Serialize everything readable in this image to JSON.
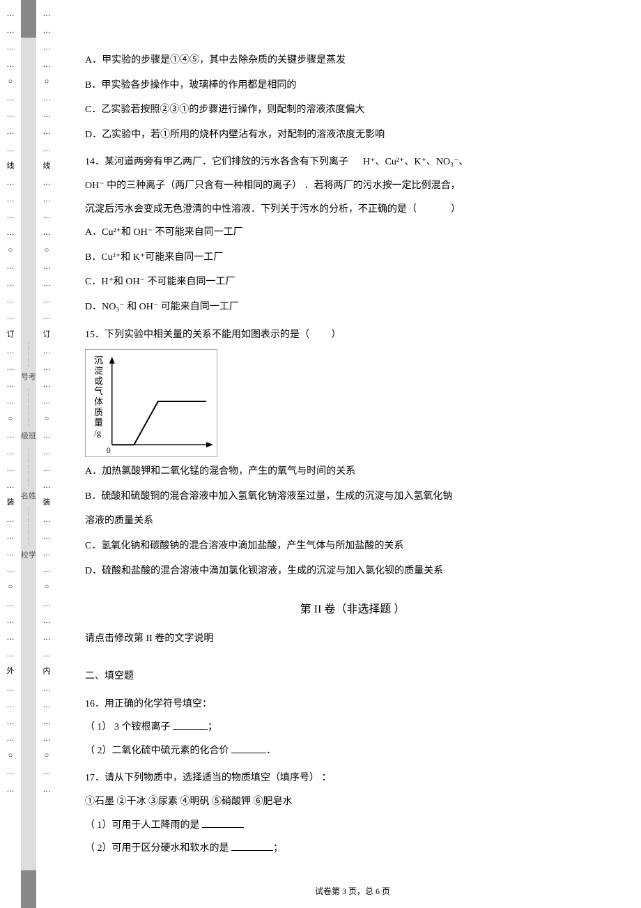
{
  "margin_outer": {
    "marks": [
      "…",
      "…",
      "…",
      "…",
      "○",
      "…",
      "…",
      "…",
      "…",
      "线",
      "…",
      "…",
      "…",
      "…",
      "○",
      "…",
      "…",
      "…",
      "…",
      "订",
      "…",
      "…",
      "…",
      "…",
      "○",
      "…",
      "…",
      "…",
      "…",
      "装",
      "…",
      "…",
      "…",
      "…",
      "○",
      "…",
      "…",
      "…",
      "…",
      "外",
      "…",
      "…",
      "…",
      "…",
      "○",
      "…",
      "…"
    ]
  },
  "margin_inner": {
    "marks": [
      "…",
      "…",
      "…",
      "…",
      "○",
      "…",
      "…",
      "…",
      "…",
      "线",
      "…",
      "…",
      "…",
      "…",
      "○",
      "…",
      "…",
      "…",
      "…",
      "订",
      "…",
      "…",
      "…",
      "…",
      "○",
      "…",
      "…",
      "…",
      "…",
      "装",
      "…",
      "…",
      "…",
      "…",
      "○",
      "…",
      "…",
      "…",
      "…",
      "内",
      "…",
      "…",
      "…",
      "…",
      "○",
      "…",
      "…"
    ]
  },
  "side_labels": {
    "kao": "号考",
    "ban": "级班",
    "xing": "名姓",
    "xiao": "校学"
  },
  "q13": {
    "A": "A．甲实验的步骤是①④⑤，其中去除杂质的关键步骤是蒸发",
    "B": "B．甲实验各步操作中，玻璃棒的作用都是相同的",
    "C": "C．乙实验若按照②③①的步骤进行操作，则配制的溶液浓度偏大",
    "D": "D．乙实验中，若①所用的烧杯内壁沾有水，对配制的溶液浓度无影响"
  },
  "q14": {
    "stem_a": "14．某河道两旁有甲乙两厂．它们排放的污水各含有下列离子",
    "ions": "H⁺、Cu²⁺、K⁺、NO₃⁻、",
    "stem_b": "OH⁻ 中的三种离子（两厂只含有一种相同的离子）   ．若将两厂的污水按一定比例混合，",
    "stem_c": "沉淀后污水会变成无色澄清的中性溶液．下列关于污水的分析，不正确的是（",
    "close": "）",
    "A": "A．Cu²⁺和 OH⁻ 不可能来自同一工厂",
    "B": "B．Cu²⁺和   K⁺可能来自同一工厂",
    "C": "C．H⁺和 OH⁻ 不可能来自同一工厂",
    "D": "D．NO₃⁻ 和 OH⁻  可能来自同一工厂"
  },
  "q15": {
    "stem": "15．下列实验中相关量的关系不能用如图表示的是（",
    "close": "）",
    "ylabel": "沉淀或气体质量/g",
    "origin": "0",
    "A": "A．加热氯酸钾和二氧化锰的混合物，产生的氧气与时间的关系",
    "B": "B．硫酸和硫酸铜的混合溶液中加入氢氧化钠溶液至过量，生成的沉淀与加入氢氧化钠",
    "B2": "溶液的质量关系",
    "C": "C．氢氧化钠和碳酸钠的混合溶液中滴加盐酸，产生气体与所加盐酸的关系",
    "D": "D．硫酸和盐酸的混合溶液中滴加氯化钡溶液，生成的沉淀与加入氯化钡的质量关系"
  },
  "section2": {
    "title": "第 II  卷（非选择题 ）",
    "note": "请点击修改第   II 卷的文字说明"
  },
  "part2_head": "二、填空题",
  "q16": {
    "stem": "16．用正确的化学符号填空：",
    "p1a": "（ 1） 3 个铵根离子  ",
    "p1b": "；",
    "p2a": "（ 2）二氧化硫中硫元素的化合价    ",
    "p2b": "．"
  },
  "q17": {
    "stem": "17．请从下列物质中，选择适当的物质填空（填序号）     ：",
    "opts": "①石墨        ②干冰        ③尿素         ④明矾        ⑤硝酸钾        ⑥肥皂水",
    "p1a": "（ 1）可用于人工降雨的是   ",
    "p2a": "（ 2）可用于区分硬水和软水的是    ",
    "p2b": "；"
  },
  "footer": "试卷第 3 页，总 6 页",
  "chart_data": {
    "type": "line",
    "title": "",
    "xlabel": "",
    "ylabel": "沉淀或气体质量/g",
    "x": [
      0,
      1,
      2,
      3,
      5
    ],
    "values": [
      0,
      0,
      2,
      2,
      2
    ],
    "xlim": [
      0,
      5
    ],
    "ylim": [
      0,
      3
    ]
  }
}
